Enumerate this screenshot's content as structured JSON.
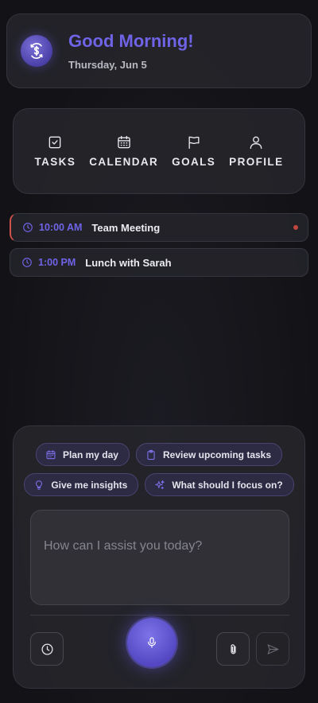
{
  "header": {
    "greeting": "Good Morning!",
    "date": "Thursday, Jun 5",
    "logo_icon": "dollar-chat-icon"
  },
  "nav": {
    "items": [
      {
        "label": "TASKS",
        "icon": "checkbox-icon"
      },
      {
        "label": "CALENDAR",
        "icon": "calendar-icon"
      },
      {
        "label": "GOALS",
        "icon": "flag-icon"
      },
      {
        "label": "PROFILE",
        "icon": "user-icon"
      }
    ]
  },
  "events": [
    {
      "time": "10:00 AM",
      "title": "Team Meeting",
      "status_dot": true
    },
    {
      "time": "1:00 PM",
      "title": "Lunch with Sarah",
      "status_dot": false
    }
  ],
  "assistant": {
    "chips": [
      {
        "label": "Plan my day",
        "icon": "calendar-icon"
      },
      {
        "label": "Review upcoming tasks",
        "icon": "clipboard-icon"
      },
      {
        "label": "Give me insights",
        "icon": "lightbulb-icon"
      },
      {
        "label": "What should I focus on?",
        "icon": "sparkles-icon"
      }
    ],
    "input_placeholder": "How can I assist you today?",
    "input_value": ""
  },
  "colors": {
    "accent": "#6f63e6",
    "background": "#16161a",
    "card": "#26262c",
    "alert": "#c0463e"
  }
}
